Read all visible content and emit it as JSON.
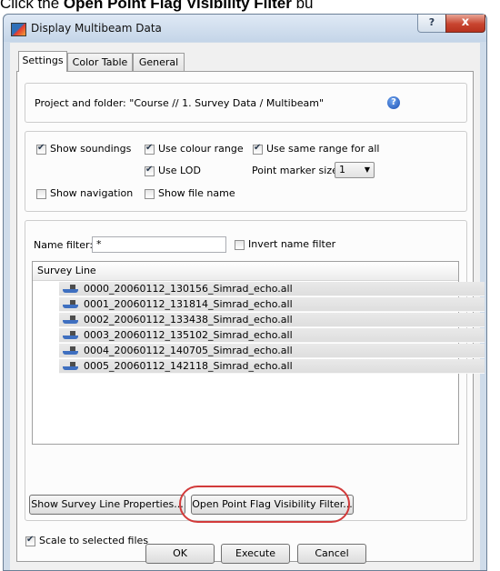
{
  "caption": {
    "prefix": "Click the ",
    "bold": "Open Point Flag Visibility Filter",
    "suffix": " bu"
  },
  "window": {
    "title": "Display Multibeam Data",
    "help_glyph": "?",
    "close_glyph": "x"
  },
  "tabs": [
    {
      "label": "Settings",
      "active": true
    },
    {
      "label": "Color Table",
      "active": false
    },
    {
      "label": "General",
      "active": false
    }
  ],
  "project": {
    "text": "Project and folder: \"Course // 1. Survey Data / Multibeam\"",
    "help_glyph": "?"
  },
  "options": {
    "show_soundings": {
      "label": "Show soundings",
      "checked": true
    },
    "use_colour_range": {
      "label": "Use colour range",
      "checked": true
    },
    "use_same_range": {
      "label": "Use same range for all",
      "checked": true
    },
    "use_lod": {
      "label": "Use LOD",
      "checked": true
    },
    "point_marker_size_label": "Point marker size:",
    "point_marker_size_value": "1",
    "show_navigation": {
      "label": "Show navigation",
      "checked": false
    },
    "show_file_name": {
      "label": "Show file name",
      "checked": false
    }
  },
  "filter": {
    "name_filter_label": "Name filter:",
    "name_filter_value": "*",
    "invert_label": "Invert name filter",
    "invert_checked": false
  },
  "survey_list": {
    "header": "Survey Line",
    "rows": [
      "0000_20060112_130156_Simrad_echo.all",
      "0001_20060112_131814_Simrad_echo.all",
      "0002_20060112_133438_Simrad_echo.all",
      "0003_20060112_135102_Simrad_echo.all",
      "0004_20060112_140705_Simrad_echo.all",
      "0005_20060112_142118_Simrad_echo.all"
    ]
  },
  "buttons": {
    "show_properties": "Show Survey Line Properties...",
    "open_filter": "Open Point Flag Visibility Filter...",
    "ok": "OK",
    "execute": "Execute",
    "cancel": "Cancel"
  },
  "scale": {
    "label": "Scale to selected files",
    "checked": true
  },
  "colors": {
    "highlight": "#d23a3a",
    "titlebar": "#c4d5e8",
    "close": "#c8442f"
  },
  "icons": {
    "app": "app-icon",
    "help": "help-icon",
    "ship": "ship-icon",
    "dropdown": "chevron-down-icon"
  }
}
